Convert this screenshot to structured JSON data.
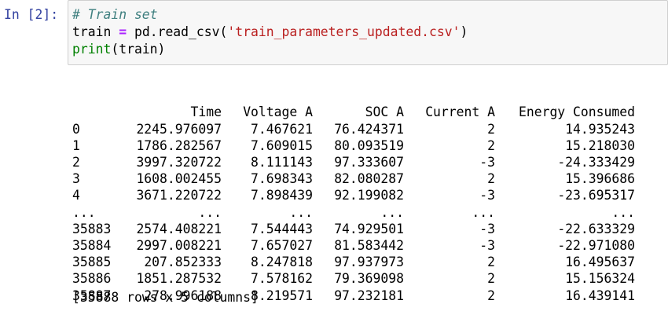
{
  "prompt": "In [2]:",
  "code": {
    "comment": "# Train set",
    "line2_var": "train",
    "line2_op": "=",
    "line2_call": "pd.read_csv(",
    "line2_str": "'train_parameters_updated.csv'",
    "line2_close": ")",
    "line3_builtin": "print",
    "line3_args": "(train)"
  },
  "output": {
    "columns": [
      "Time",
      "Voltage A",
      "SOC A",
      "Current A",
      "Energy Consumed"
    ],
    "rows": [
      {
        "index": "0",
        "cells": [
          "2245.976097",
          "7.467621",
          "76.424371",
          "2",
          "14.935243"
        ]
      },
      {
        "index": "1",
        "cells": [
          "1786.282567",
          "7.609015",
          "80.093519",
          "2",
          "15.218030"
        ]
      },
      {
        "index": "2",
        "cells": [
          "3997.320722",
          "8.111143",
          "97.333607",
          "-3",
          "-24.333429"
        ]
      },
      {
        "index": "3",
        "cells": [
          "1608.002455",
          "7.698343",
          "82.080287",
          "2",
          "15.396686"
        ]
      },
      {
        "index": "4",
        "cells": [
          "3671.220722",
          "7.898439",
          "92.199082",
          "-3",
          "-23.695317"
        ]
      },
      {
        "index": "...",
        "cells": [
          "...",
          "...",
          "...",
          "...",
          "..."
        ]
      },
      {
        "index": "35883",
        "cells": [
          "2574.408221",
          "7.544443",
          "74.929501",
          "-3",
          "-22.633329"
        ]
      },
      {
        "index": "35884",
        "cells": [
          "2997.008221",
          "7.657027",
          "81.583442",
          "-3",
          "-22.971080"
        ]
      },
      {
        "index": "35885",
        "cells": [
          "207.852333",
          "8.247818",
          "97.937973",
          "2",
          "16.495637"
        ]
      },
      {
        "index": "35886",
        "cells": [
          "1851.287532",
          "7.578162",
          "79.369098",
          "2",
          "15.156324"
        ]
      },
      {
        "index": "35887",
        "cells": [
          "278.996188",
          "8.219571",
          "97.232181",
          "2",
          "16.439141"
        ]
      }
    ],
    "summary": "[35888 rows x 5 columns]"
  }
}
